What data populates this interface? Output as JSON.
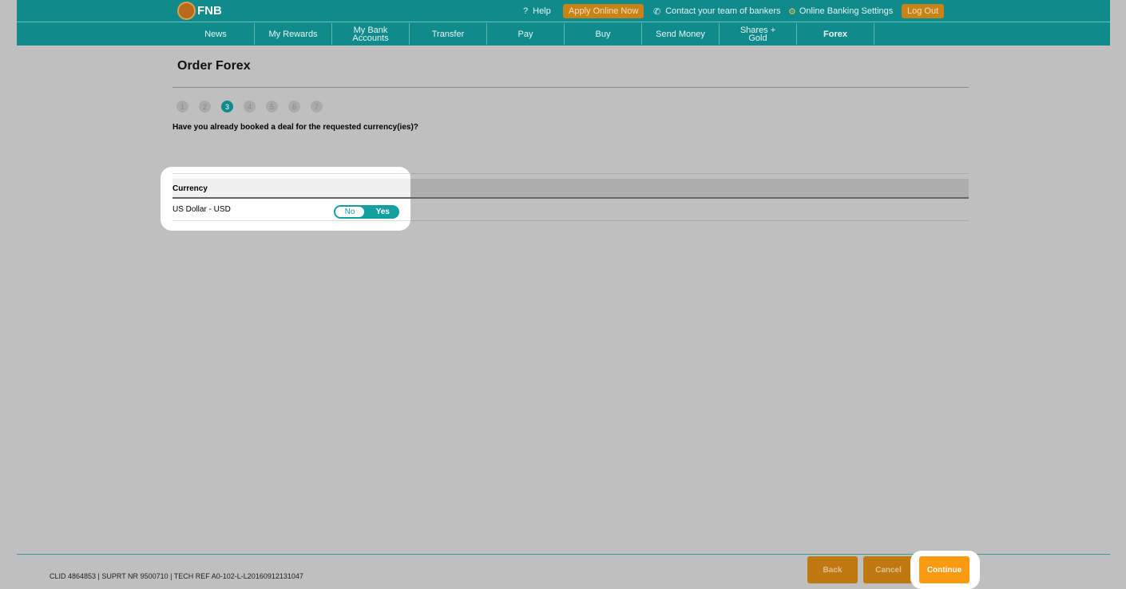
{
  "header": {
    "logo": "FNB",
    "help": "Help",
    "apply": "Apply Online Now",
    "contact": "Contact your team of bankers",
    "settings": "Online Banking Settings",
    "logout": "Log Out"
  },
  "nav": [
    "News",
    "My Rewards",
    "My Bank Accounts",
    "Transfer",
    "Pay",
    "Buy",
    "Send Money",
    "Shares + Gold",
    "Forex"
  ],
  "page": {
    "title": "Order Forex",
    "steps": [
      "1",
      "2",
      "3",
      "4",
      "5",
      "6",
      "7"
    ],
    "current_step": 3,
    "question": "Have you already booked a deal for the requested currency(ies)?"
  },
  "table": {
    "header": "Currency",
    "rows": [
      {
        "currency": "US Dollar - USD",
        "toggle_no": "No",
        "toggle_yes": "Yes",
        "selected": "Yes"
      }
    ]
  },
  "footer": {
    "ref": "CLID 4864853 | SUPRT NR 9500710 | TECH REF A0-102-L-L20160912131047",
    "back": "Back",
    "cancel": "Cancel",
    "continue": "Continue"
  },
  "colors": {
    "brand": "#0f8b8b",
    "accent": "#f99a10"
  }
}
